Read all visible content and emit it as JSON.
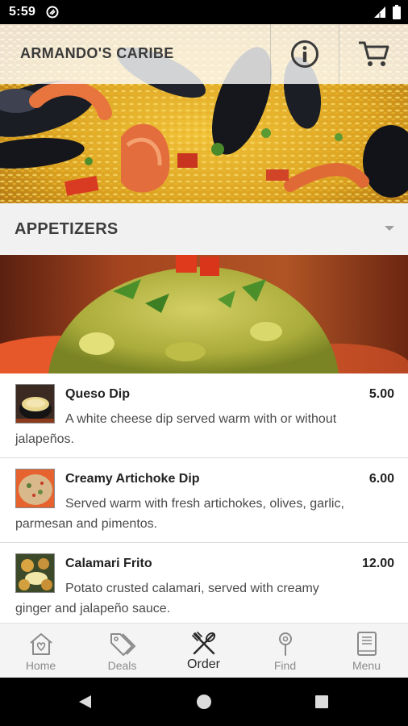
{
  "status_bar": {
    "time": "5:59"
  },
  "header": {
    "title": "ARMANDO'S CARIBE"
  },
  "category": {
    "title": "APPETIZERS"
  },
  "menu_items": [
    {
      "name": "Queso Dip",
      "price": "5.00",
      "description": "A white cheese dip served warm with or without jalapeños."
    },
    {
      "name": "Creamy Artichoke Dip",
      "price": "6.00",
      "description": "Served warm with fresh artichokes, olives, garlic, parmesan and pimentos."
    },
    {
      "name": "Calamari Frito",
      "price": "12.00",
      "description": "Potato crusted calamari, served with creamy ginger and jalapeño sauce."
    }
  ],
  "bottom_nav": {
    "items": [
      {
        "label": "Home",
        "icon": "home-heart-icon"
      },
      {
        "label": "Deals",
        "icon": "tags-icon"
      },
      {
        "label": "Order",
        "icon": "utensils-cross-icon",
        "active": true
      },
      {
        "label": "Find",
        "icon": "map-pin-icon"
      },
      {
        "label": "Menu",
        "icon": "book-icon"
      }
    ]
  },
  "colors": {
    "header_text": "#3a3a3a",
    "category_bar": "#f1f1f1",
    "nav_bar": "#f4f4f4",
    "active_nav": "#2a2a2a",
    "inactive_nav": "#8a8a8a"
  }
}
